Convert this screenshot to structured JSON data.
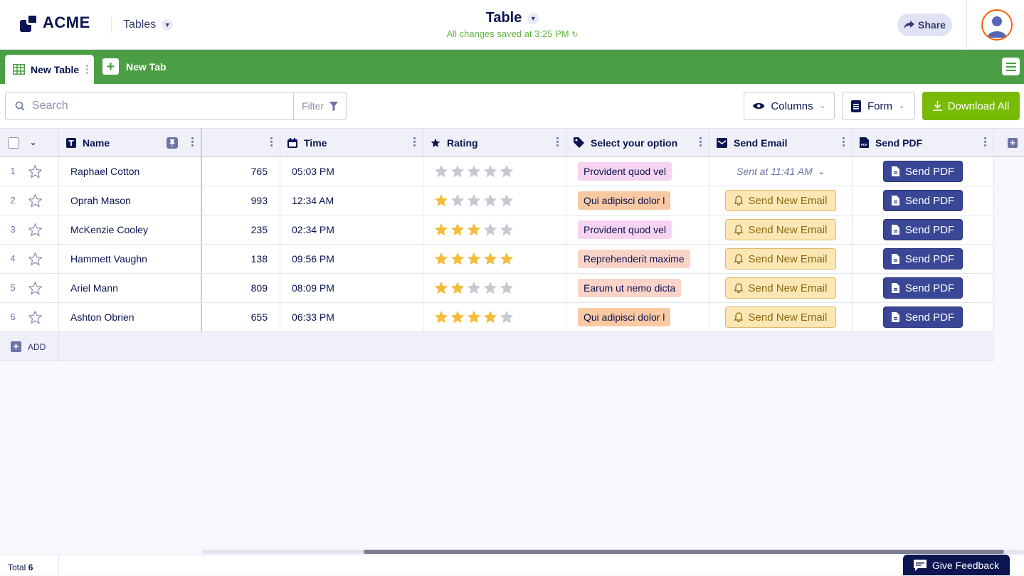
{
  "header": {
    "logo_text": "ACME",
    "app_switch_label": "Tables",
    "title": "Table",
    "save_status": "All changes saved at 3:25 PM",
    "share_label": "Share"
  },
  "tabs": {
    "active_label": "New Table",
    "new_tab_label": "New Tab"
  },
  "toolbar": {
    "search_placeholder": "Search",
    "filter_label": "Filter",
    "columns_label": "Columns",
    "form_label": "Form",
    "download_label": "Download All"
  },
  "columns": {
    "name": "Name",
    "time": "Time",
    "rating": "Rating",
    "select": "Select your option",
    "send_email": "Send Email",
    "send_pdf": "Send PDF"
  },
  "rows": [
    {
      "num": "1",
      "name": "Raphael Cotton",
      "number": "765",
      "time": "05:03 PM",
      "rating": 0,
      "option": "Provident quod vel",
      "email": "Sent at 11:41 AM",
      "email_sent": true,
      "pdf": "Send PDF"
    },
    {
      "num": "2",
      "name": "Oprah Mason",
      "number": "993",
      "time": "12:34 AM",
      "rating": 1,
      "option": "Qui adipisci dolor l",
      "email": "Send New Email",
      "email_sent": false,
      "pdf": "Send PDF"
    },
    {
      "num": "3",
      "name": "McKenzie Cooley",
      "number": "235",
      "time": "02:34 PM",
      "rating": 3,
      "option": "Provident quod vel",
      "email": "Send New Email",
      "email_sent": false,
      "pdf": "Send PDF"
    },
    {
      "num": "4",
      "name": "Hammett Vaughn",
      "number": "138",
      "time": "09:56 PM",
      "rating": 5,
      "option": "Reprehenderit maxime",
      "email": "Send New Email",
      "email_sent": false,
      "pdf": "Send PDF"
    },
    {
      "num": "5",
      "name": "Ariel Mann",
      "number": "809",
      "time": "08:09 PM",
      "rating": 2,
      "option": "Earum ut nemo dicta",
      "email": "Send New Email",
      "email_sent": false,
      "pdf": "Send PDF"
    },
    {
      "num": "6",
      "name": "Ashton Obrien",
      "number": "655",
      "time": "06:33 PM",
      "rating": 4,
      "option": "Qui adipisci dolor l",
      "email": "Send New Email",
      "email_sent": false,
      "pdf": "Send PDF"
    }
  ],
  "option_colors": {
    "Provident quod vel": "#f6d3f0",
    "Qui adipisci dolor l": "#f8c9a2",
    "Reprehenderit maxime": "#fbd4c9",
    "Earum ut nemo dicta": "#fbd4c9"
  },
  "add_label": "ADD",
  "footer": {
    "total_label": "Total",
    "total_value": "6",
    "feedback_label": "Give Feedback"
  },
  "colors": {
    "tab_green": "#4c9e45",
    "download_green": "#78bb07",
    "navy": "#0a1551",
    "pdf_blue": "#3a4796",
    "star_gold": "#f3bc3a",
    "star_grey": "#c6c8d2"
  }
}
